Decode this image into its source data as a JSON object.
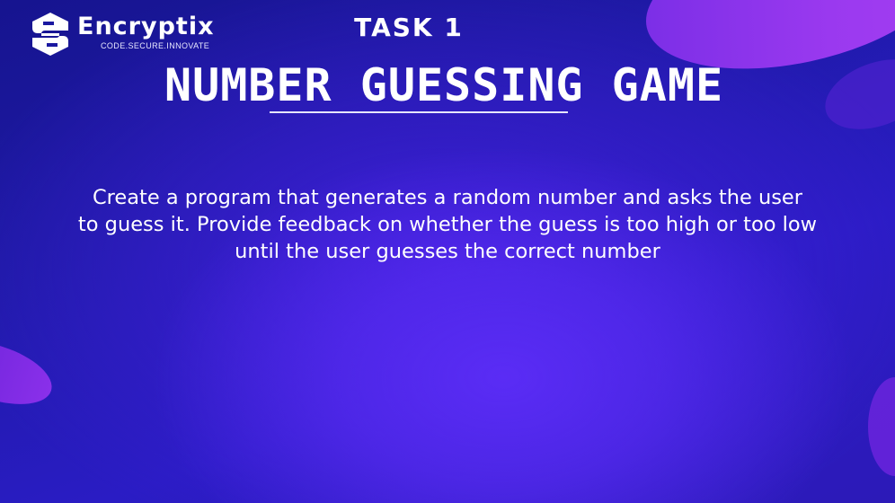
{
  "brand": {
    "name": "Encryptix",
    "tagline": "CODE.SECURE.INNOVATE",
    "logo_icon": "s-shield-logo-icon"
  },
  "slide": {
    "task_label": "TASK 1",
    "title": "NUMBER GUESSING GAME",
    "description_lines": [
      "Create a program that generates a random number and asks the user",
      "to guess it. Provide feedback on whether the guess is too high or too low",
      "until the user guesses the correct number"
    ]
  },
  "colors": {
    "background_dark": "#16148f",
    "background_glow": "#5a2cf5",
    "accent_purple": "#9a39ef",
    "text": "#ffffff"
  }
}
